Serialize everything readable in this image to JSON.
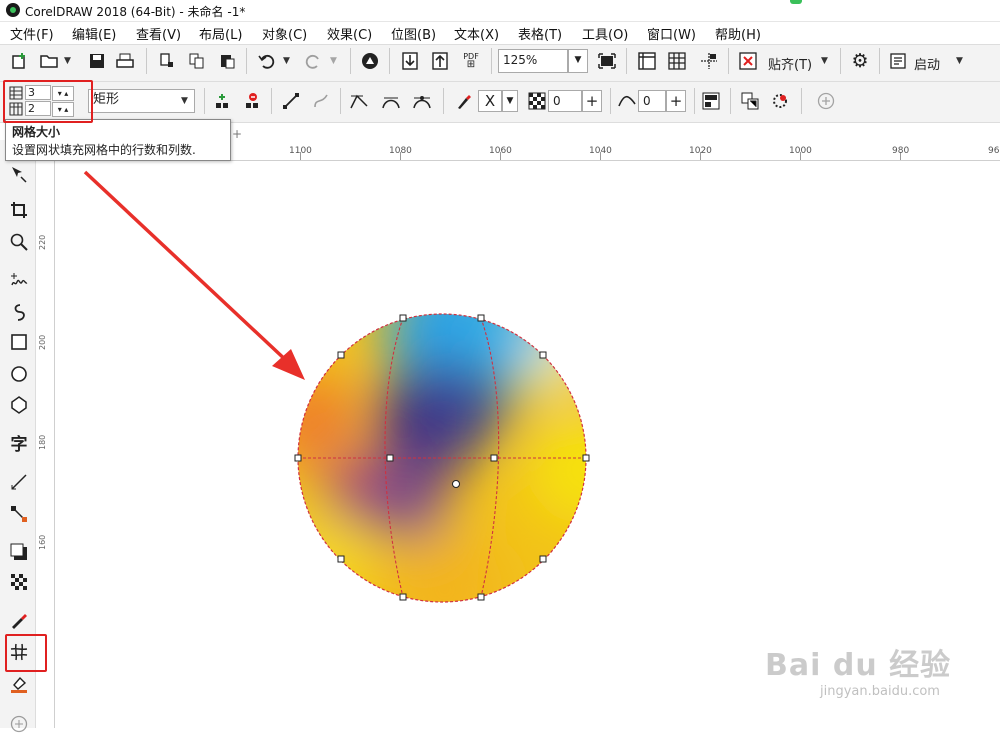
{
  "window": {
    "title": "CorelDRAW 2018 (64-Bit) - 未命名 -1*"
  },
  "menu": [
    "文件(F)",
    "编辑(E)",
    "查看(V)",
    "布局(L)",
    "对象(C)",
    "效果(C)",
    "位图(B)",
    "文本(X)",
    "表格(T)",
    "工具(O)",
    "窗口(W)",
    "帮助(H)"
  ],
  "toolbar1": {
    "zoom_value": "125%",
    "pdf_label": "PDF",
    "snap_label": "贴齐(T)",
    "launch_label": "启动"
  },
  "toolbar2": {
    "rows_value": "3",
    "cols_value": "2",
    "selection_mode": "矩形",
    "transparency_value": "0",
    "smoothness_value": "0",
    "x_label": "X"
  },
  "tooltip": {
    "title": "网格大小",
    "description": "设置网状填充网格中的行数和列数."
  },
  "ruler": {
    "top_labels": [
      "1100",
      "1080",
      "1060",
      "1040",
      "1020",
      "1000",
      "980",
      "96"
    ],
    "left_labels": [
      "220",
      "200",
      "180",
      "160"
    ]
  },
  "watermark": {
    "main": "Bai du 经验",
    "sub": "jingyan.baidu.com"
  },
  "colors": {
    "highlight": "#e02020",
    "mesh_line": "#d03040",
    "arrow": "#e8302a"
  }
}
